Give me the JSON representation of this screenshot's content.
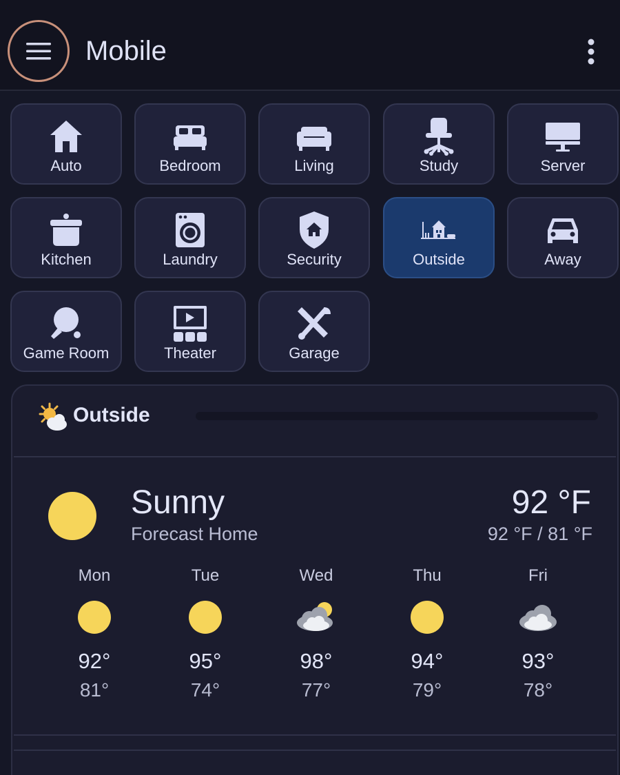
{
  "header": {
    "title": "Mobile",
    "menu_icon": "hamburger-icon",
    "more_icon": "more-vert-icon",
    "accent": "#c8907a"
  },
  "tiles": [
    {
      "label": "Auto",
      "icon": "home-icon"
    },
    {
      "label": "Bedroom",
      "icon": "bed-icon"
    },
    {
      "label": "Living",
      "icon": "sofa-icon"
    },
    {
      "label": "Study",
      "icon": "desk-chair-icon"
    },
    {
      "label": "Server",
      "icon": "monitor-icon"
    },
    {
      "label": "Kitchen",
      "icon": "pot-icon"
    },
    {
      "label": "Laundry",
      "icon": "washing-machine-icon"
    },
    {
      "label": "Security",
      "icon": "shield-home-icon"
    },
    {
      "label": "Outside",
      "icon": "house-outside-icon",
      "active": true
    },
    {
      "label": "Away",
      "icon": "car-icon"
    },
    {
      "label": "Game Room",
      "icon": "ping-pong-icon"
    },
    {
      "label": "Theater",
      "icon": "theater-icon"
    },
    {
      "label": "Garage",
      "icon": "tools-icon"
    }
  ],
  "card": {
    "title": "Outside",
    "icon": "sun-cloud-icon",
    "weather": {
      "condition": "Sunny",
      "subtitle": "Forecast Home",
      "temperature": "92 °F",
      "range": "92 °F / 81 °F",
      "icon": "sun-icon",
      "forecast": [
        {
          "day": "Mon",
          "icon": "sun-icon",
          "high": "92°",
          "low": "81°"
        },
        {
          "day": "Tue",
          "icon": "sun-icon",
          "high": "95°",
          "low": "74°"
        },
        {
          "day": "Wed",
          "icon": "partly-cloudy-icon",
          "high": "98°",
          "low": "77°"
        },
        {
          "day": "Thu",
          "icon": "sun-icon",
          "high": "94°",
          "low": "79°"
        },
        {
          "day": "Fri",
          "icon": "cloud-icon",
          "high": "93°",
          "low": "78°"
        }
      ]
    }
  },
  "colors": {
    "background": "#151726",
    "tile": "#20223a",
    "tile_active": "#1b3a6d",
    "sun": "#f6d55a"
  }
}
